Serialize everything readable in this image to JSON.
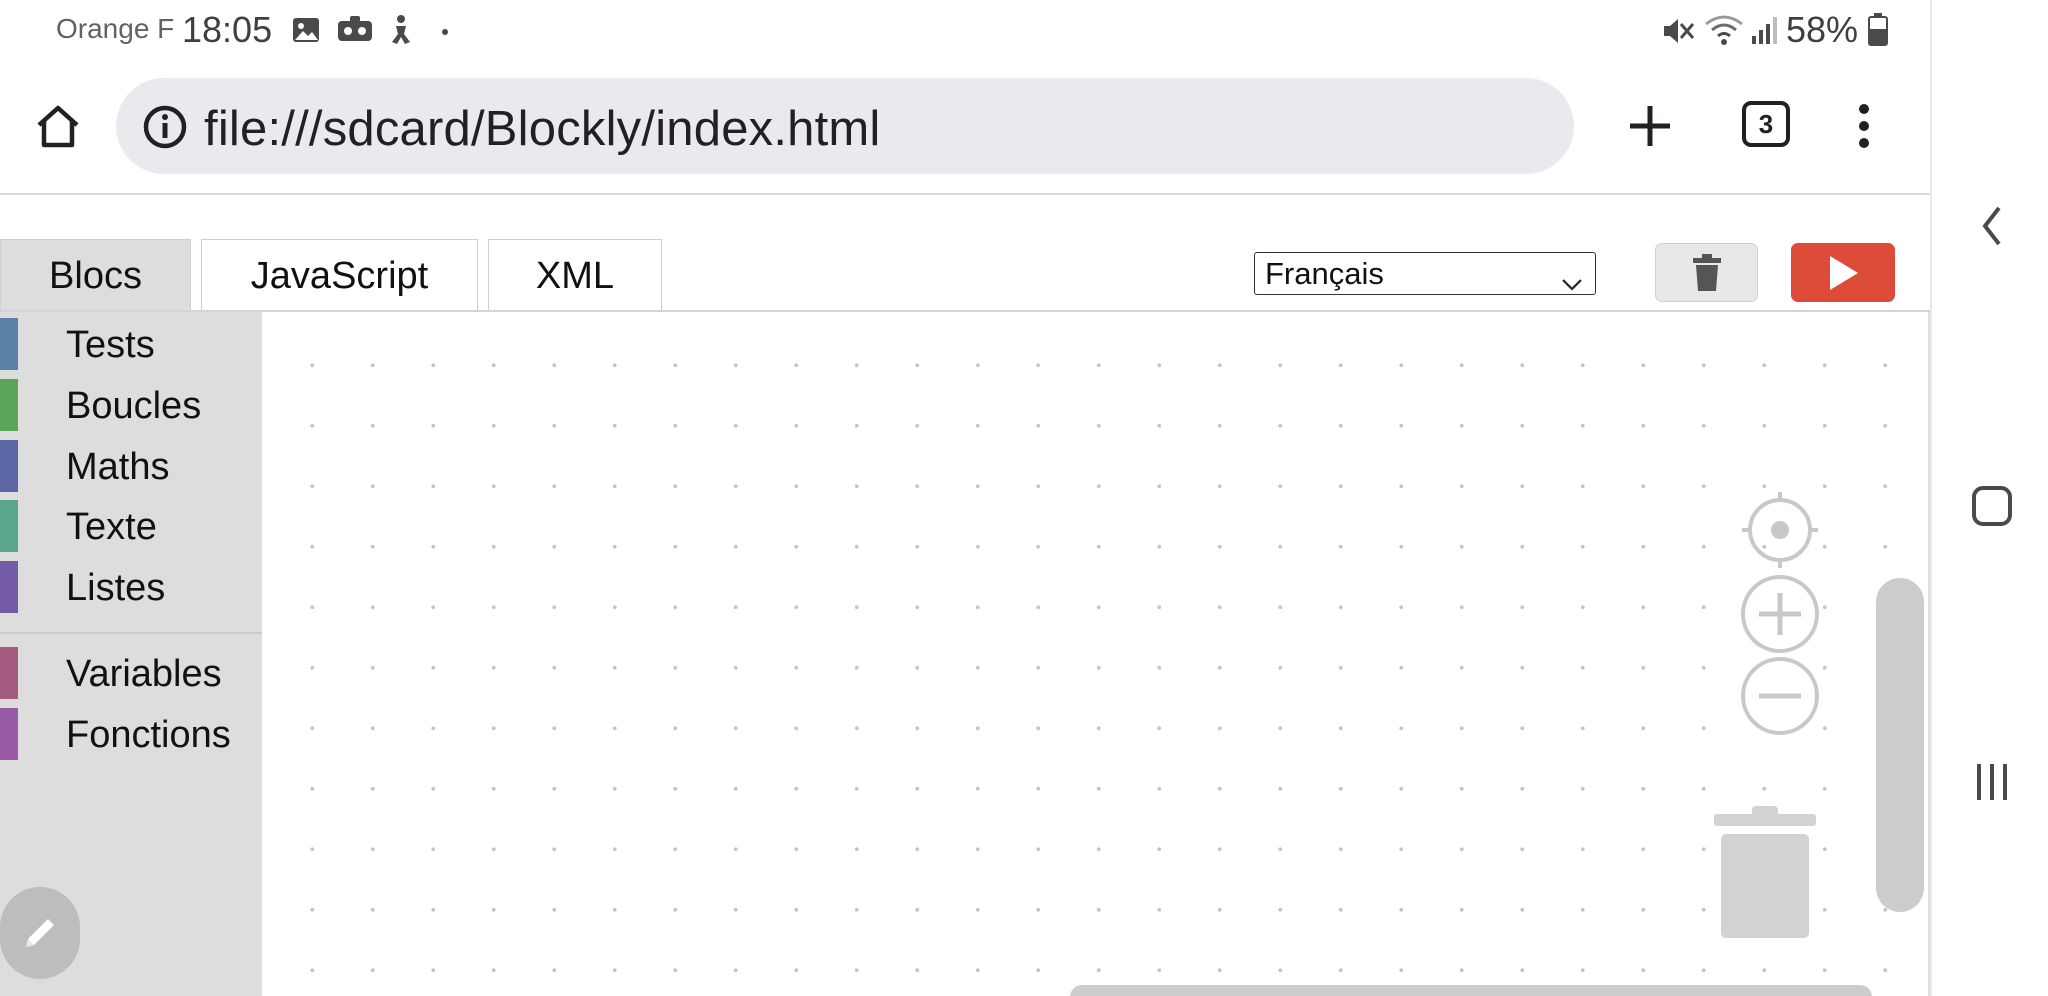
{
  "status_bar": {
    "carrier": "Orange F",
    "time": "18:05",
    "notification_icons": [
      "image-icon",
      "vr-icon",
      "accessibility-icon",
      "dot-icon"
    ],
    "system_icons": [
      "mute-icon",
      "wifi-icon",
      "signal-icon"
    ],
    "battery": "58%"
  },
  "browser": {
    "url": "file:///sdcard/Blockly/index.html",
    "tab_count": "3"
  },
  "app": {
    "tabs": [
      {
        "label": "Blocs",
        "active": true
      },
      {
        "label": "JavaScript",
        "active": false
      },
      {
        "label": "XML",
        "active": false
      }
    ],
    "language": "Français",
    "run_color": "#dd4b39"
  },
  "toolbox": {
    "categories": [
      {
        "label": "Tests",
        "color": "#5b80a5"
      },
      {
        "label": "Boucles",
        "color": "#5ba55b"
      },
      {
        "label": "Maths",
        "color": "#5b67a5"
      },
      {
        "label": "Texte",
        "color": "#5ba58c"
      },
      {
        "label": "Listes",
        "color": "#745ba5"
      },
      {
        "label": "Variables",
        "color": "#a55b80"
      },
      {
        "label": "Fonctions",
        "color": "#995ba5"
      }
    ]
  }
}
